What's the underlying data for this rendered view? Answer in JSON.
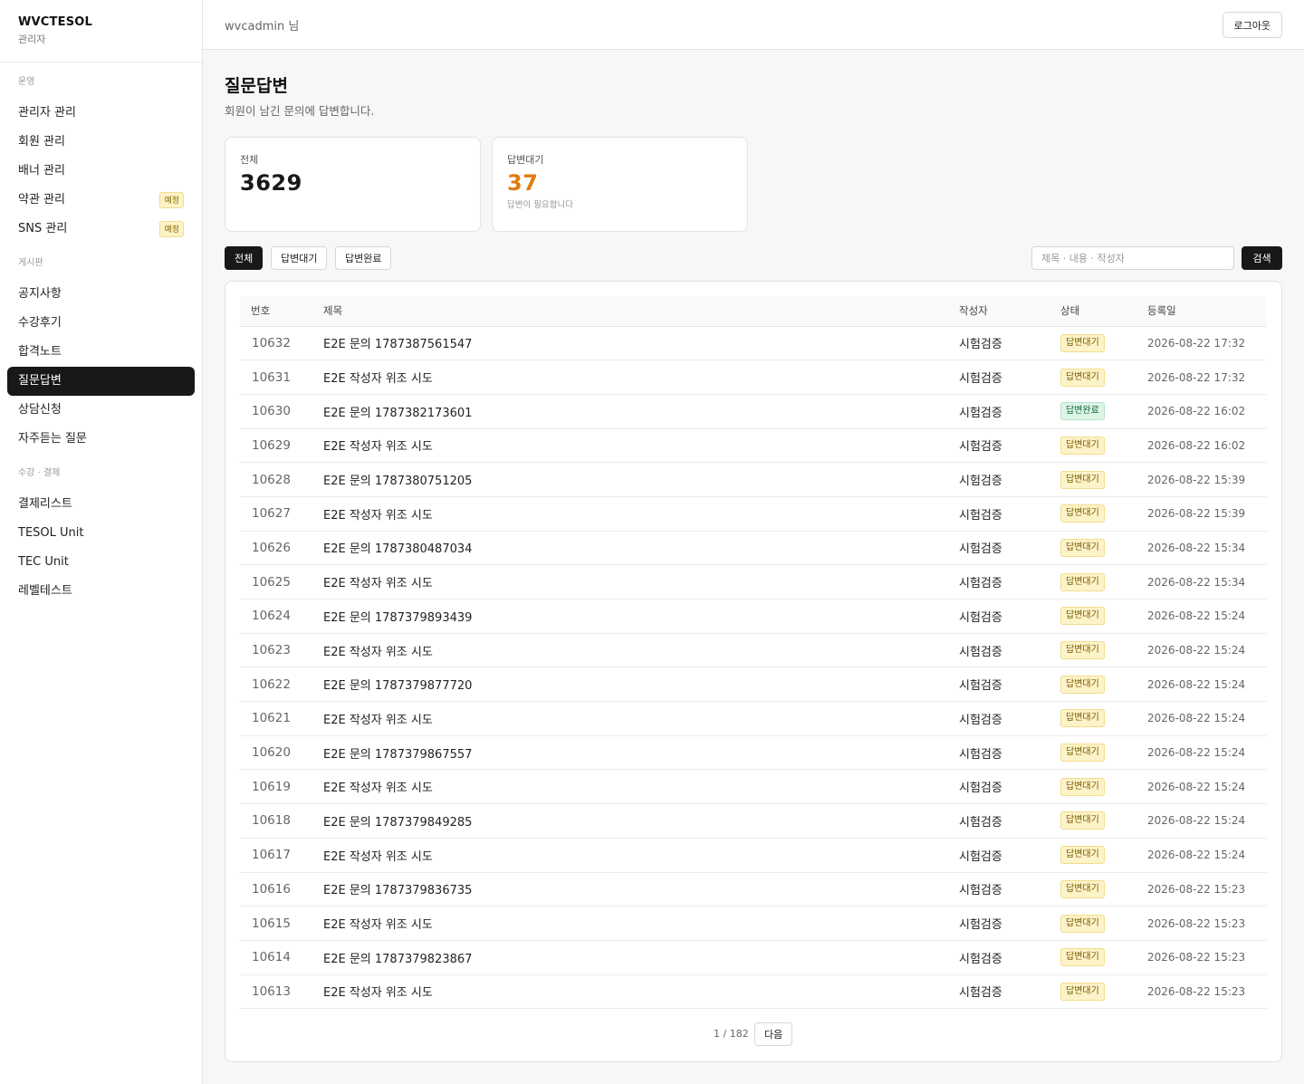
{
  "brand": {
    "name": "WVCTESOL",
    "sub": "관리자"
  },
  "sidebar": {
    "sections": [
      {
        "heading": "운영",
        "items": [
          {
            "label": "관리자 관리"
          },
          {
            "label": "회원 관리"
          },
          {
            "label": "배너 관리"
          },
          {
            "label": "약관 관리",
            "badge": "예정"
          },
          {
            "label": "SNS 관리",
            "badge": "예정"
          }
        ]
      },
      {
        "heading": "게시판",
        "items": [
          {
            "label": "공지사항"
          },
          {
            "label": "수강후기"
          },
          {
            "label": "합격노트"
          },
          {
            "label": "질문답변",
            "active": true
          },
          {
            "label": "상담신청"
          },
          {
            "label": "자주듣는 질문"
          }
        ]
      },
      {
        "heading": "수강 · 결제",
        "items": [
          {
            "label": "결제리스트"
          },
          {
            "label": "TESOL Unit"
          },
          {
            "label": "TEC Unit"
          },
          {
            "label": "레벨테스트"
          }
        ]
      }
    ]
  },
  "topbar": {
    "user": "wvcadmin 님",
    "logout": "로그아웃"
  },
  "page": {
    "title": "질문답변",
    "desc": "회원이 남긴 문의에 답변합니다."
  },
  "stats": {
    "total": {
      "label": "전체",
      "value": "3629"
    },
    "waiting": {
      "label": "답변대기",
      "value": "37",
      "note": "답변이 필요합니다",
      "color": "#e07b12"
    }
  },
  "filters": {
    "all": "전체",
    "waiting": "답변대기",
    "done": "답변완료"
  },
  "search": {
    "placeholder": "제목 · 내용 · 작성자",
    "button": "검색"
  },
  "table": {
    "headers": {
      "num": "번호",
      "title": "제목",
      "author": "작성자",
      "status": "상태",
      "date": "등록일"
    },
    "rows": [
      {
        "num": "10632",
        "title": "E2E 문의 1787387561547",
        "author": "시험검증",
        "status": "답변대기",
        "date": "2026-08-22 17:32"
      },
      {
        "num": "10631",
        "title": "E2E 작성자 위조 시도",
        "author": "시험검증",
        "status": "답변대기",
        "date": "2026-08-22 17:32"
      },
      {
        "num": "10630",
        "title": "E2E 문의 1787382173601",
        "author": "시험검증",
        "status": "답변완료",
        "date": "2026-08-22 16:02"
      },
      {
        "num": "10629",
        "title": "E2E 작성자 위조 시도",
        "author": "시험검증",
        "status": "답변대기",
        "date": "2026-08-22 16:02"
      },
      {
        "num": "10628",
        "title": "E2E 문의 1787380751205",
        "author": "시험검증",
        "status": "답변대기",
        "date": "2026-08-22 15:39"
      },
      {
        "num": "10627",
        "title": "E2E 작성자 위조 시도",
        "author": "시험검증",
        "status": "답변대기",
        "date": "2026-08-22 15:39"
      },
      {
        "num": "10626",
        "title": "E2E 문의 1787380487034",
        "author": "시험검증",
        "status": "답변대기",
        "date": "2026-08-22 15:34"
      },
      {
        "num": "10625",
        "title": "E2E 작성자 위조 시도",
        "author": "시험검증",
        "status": "답변대기",
        "date": "2026-08-22 15:34"
      },
      {
        "num": "10624",
        "title": "E2E 문의 1787379893439",
        "author": "시험검증",
        "status": "답변대기",
        "date": "2026-08-22 15:24"
      },
      {
        "num": "10623",
        "title": "E2E 작성자 위조 시도",
        "author": "시험검증",
        "status": "답변대기",
        "date": "2026-08-22 15:24"
      },
      {
        "num": "10622",
        "title": "E2E 문의 1787379877720",
        "author": "시험검증",
        "status": "답변대기",
        "date": "2026-08-22 15:24"
      },
      {
        "num": "10621",
        "title": "E2E 작성자 위조 시도",
        "author": "시험검증",
        "status": "답변대기",
        "date": "2026-08-22 15:24"
      },
      {
        "num": "10620",
        "title": "E2E 문의 1787379867557",
        "author": "시험검증",
        "status": "답변대기",
        "date": "2026-08-22 15:24"
      },
      {
        "num": "10619",
        "title": "E2E 작성자 위조 시도",
        "author": "시험검증",
        "status": "답변대기",
        "date": "2026-08-22 15:24"
      },
      {
        "num": "10618",
        "title": "E2E 문의 1787379849285",
        "author": "시험검증",
        "status": "답변대기",
        "date": "2026-08-22 15:24"
      },
      {
        "num": "10617",
        "title": "E2E 작성자 위조 시도",
        "author": "시험검증",
        "status": "답변대기",
        "date": "2026-08-22 15:24"
      },
      {
        "num": "10616",
        "title": "E2E 문의 1787379836735",
        "author": "시험검증",
        "status": "답변대기",
        "date": "2026-08-22 15:23"
      },
      {
        "num": "10615",
        "title": "E2E 작성자 위조 시도",
        "author": "시험검증",
        "status": "답변대기",
        "date": "2026-08-22 15:23"
      },
      {
        "num": "10614",
        "title": "E2E 문의 1787379823867",
        "author": "시험검증",
        "status": "답변대기",
        "date": "2026-08-22 15:23"
      },
      {
        "num": "10613",
        "title": "E2E 작성자 위조 시도",
        "author": "시험검증",
        "status": "답변대기",
        "date": "2026-08-22 15:23"
      }
    ]
  },
  "pager": {
    "info": "1 / 182",
    "next": "다음"
  }
}
